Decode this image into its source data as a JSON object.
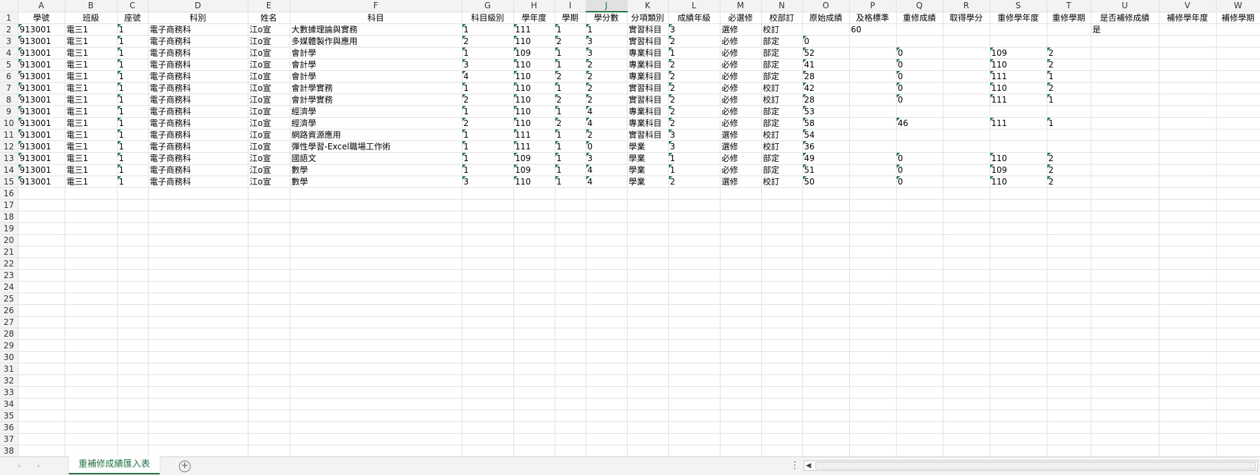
{
  "columns": [
    "A",
    "B",
    "C",
    "D",
    "E",
    "F",
    "G",
    "H",
    "I",
    "J",
    "K",
    "L",
    "M",
    "N",
    "O",
    "P",
    "Q",
    "R",
    "S",
    "T",
    "U",
    "V",
    "W"
  ],
  "selected_column": "J",
  "headers": [
    "學號",
    "班級",
    "座號",
    "科別",
    "姓名",
    "科目",
    "科目級別",
    "學年度",
    "學期",
    "學分數",
    "分項類別",
    "成績年級",
    "必選修",
    "校部訂",
    "原始成績",
    "及格標準",
    "重修成績",
    "取得學分",
    "重修學年度",
    "重修學期",
    "是否補修成績",
    "補修學年度",
    "補修學期"
  ],
  "rows": [
    [
      "913001",
      "電三1",
      "1",
      "電子商務科",
      "江o宣",
      "大數據理論與實務",
      "1",
      "111",
      "1",
      "1",
      "實習科目",
      "3",
      "選修",
      "校訂",
      "",
      "60",
      "",
      "",
      "",
      "",
      "是",
      "",
      ""
    ],
    [
      "913001",
      "電三1",
      "1",
      "電子商務科",
      "江o宣",
      "多媒體製作與應用",
      "2",
      "110",
      "2",
      "3",
      "實習科目",
      "2",
      "必修",
      "部定",
      "0",
      "",
      "",
      "",
      "",
      "",
      "",
      "",
      ""
    ],
    [
      "913001",
      "電三1",
      "1",
      "電子商務科",
      "江o宣",
      "會計學",
      "1",
      "109",
      "1",
      "3",
      "專業科目",
      "1",
      "必修",
      "部定",
      "52",
      "",
      "0",
      "",
      "109",
      "2",
      "",
      "",
      ""
    ],
    [
      "913001",
      "電三1",
      "1",
      "電子商務科",
      "江o宣",
      "會計學",
      "3",
      "110",
      "1",
      "2",
      "專業科目",
      "2",
      "必修",
      "部定",
      "41",
      "",
      "0",
      "",
      "110",
      "2",
      "",
      "",
      ""
    ],
    [
      "913001",
      "電三1",
      "1",
      "電子商務科",
      "江o宣",
      "會計學",
      "4",
      "110",
      "2",
      "2",
      "專業科目",
      "2",
      "必修",
      "部定",
      "28",
      "",
      "0",
      "",
      "111",
      "1",
      "",
      "",
      ""
    ],
    [
      "913001",
      "電三1",
      "1",
      "電子商務科",
      "江o宣",
      "會計學實務",
      "1",
      "110",
      "1",
      "2",
      "實習科目",
      "2",
      "必修",
      "校訂",
      "42",
      "",
      "0",
      "",
      "110",
      "2",
      "",
      "",
      ""
    ],
    [
      "913001",
      "電三1",
      "1",
      "電子商務科",
      "江o宣",
      "會計學實務",
      "2",
      "110",
      "2",
      "2",
      "實習科目",
      "2",
      "必修",
      "校訂",
      "28",
      "",
      "0",
      "",
      "111",
      "1",
      "",
      "",
      ""
    ],
    [
      "913001",
      "電三1",
      "1",
      "電子商務科",
      "江o宣",
      "經濟學",
      "1",
      "110",
      "1",
      "4",
      "專業科目",
      "2",
      "必修",
      "部定",
      "53",
      "",
      "",
      "",
      "",
      "",
      "",
      "",
      ""
    ],
    [
      "913001",
      "電三1",
      "1",
      "電子商務科",
      "江o宣",
      "經濟學",
      "2",
      "110",
      "2",
      "4",
      "專業科目",
      "2",
      "必修",
      "部定",
      "58",
      "",
      "46",
      "",
      "111",
      "1",
      "",
      "",
      ""
    ],
    [
      "913001",
      "電三1",
      "1",
      "電子商務科",
      "江o宣",
      "網路資源應用",
      "1",
      "111",
      "1",
      "2",
      "實習科目",
      "3",
      "選修",
      "校訂",
      "54",
      "",
      "",
      "",
      "",
      "",
      "",
      "",
      ""
    ],
    [
      "913001",
      "電三1",
      "1",
      "電子商務科",
      "江o宣",
      "彈性學習-Excel職場工作術",
      "1",
      "111",
      "1",
      "0",
      "學業",
      "3",
      "選修",
      "校訂",
      "36",
      "",
      "",
      "",
      "",
      "",
      "",
      "",
      ""
    ],
    [
      "913001",
      "電三1",
      "1",
      "電子商務科",
      "江o宣",
      "國語文",
      "1",
      "109",
      "1",
      "3",
      "學業",
      "1",
      "必修",
      "部定",
      "49",
      "",
      "0",
      "",
      "110",
      "2",
      "",
      "",
      ""
    ],
    [
      "913001",
      "電三1",
      "1",
      "電子商務科",
      "江o宣",
      "數學",
      "1",
      "109",
      "1",
      "4",
      "學業",
      "1",
      "必修",
      "部定",
      "51",
      "",
      "0",
      "",
      "109",
      "2",
      "",
      "",
      ""
    ],
    [
      "913001",
      "電三1",
      "1",
      "電子商務科",
      "江o宣",
      "數學",
      "3",
      "110",
      "1",
      "4",
      "學業",
      "2",
      "選修",
      "校訂",
      "50",
      "",
      "0",
      "",
      "110",
      "2",
      "",
      "",
      ""
    ]
  ],
  "row_numbers": [
    "1",
    "2",
    "3",
    "4",
    "5",
    "6",
    "7",
    "8",
    "9",
    "10",
    "11",
    "12",
    "13",
    "14",
    "15",
    "16",
    "17",
    "18",
    "19",
    "20",
    "21",
    "22",
    "23",
    "24",
    "25",
    "26",
    "27",
    "28",
    "29",
    "30",
    "31",
    "32",
    "33",
    "34",
    "35",
    "36",
    "37",
    "38"
  ],
  "tabbar": {
    "sheet_name": "重補修成績匯入表",
    "prev_icon": "‹",
    "next_icon": "›",
    "add_icon": "+",
    "menu_icon": "⋮",
    "scroll_left_icon": "◀"
  },
  "colors": {
    "accent": "#217346",
    "triangle": "#1e7a3d",
    "header_bg": "#f3f3f3",
    "grid": "#e1e1e1"
  }
}
